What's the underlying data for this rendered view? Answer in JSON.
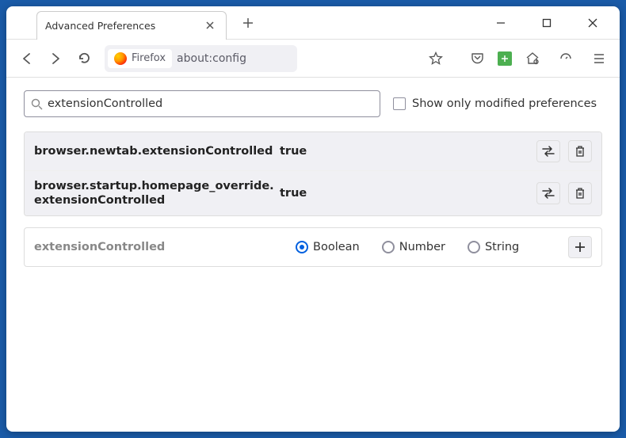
{
  "window": {
    "tab_title": "Advanced Preferences",
    "new_tab_tooltip": "New Tab"
  },
  "toolbar": {
    "firefox_label": "Firefox",
    "url": "about:config"
  },
  "search": {
    "value": "extensionControlled",
    "show_modified_label": "Show only modified preferences",
    "show_modified_checked": false
  },
  "prefs": [
    {
      "name": "browser.newtab.extensionControlled",
      "value": "true"
    },
    {
      "name": "browser.startup.homepage_override.extensionControlled",
      "value": "true"
    }
  ],
  "add": {
    "name": "extensionControlled",
    "types": [
      "Boolean",
      "Number",
      "String"
    ],
    "selected": 0
  }
}
